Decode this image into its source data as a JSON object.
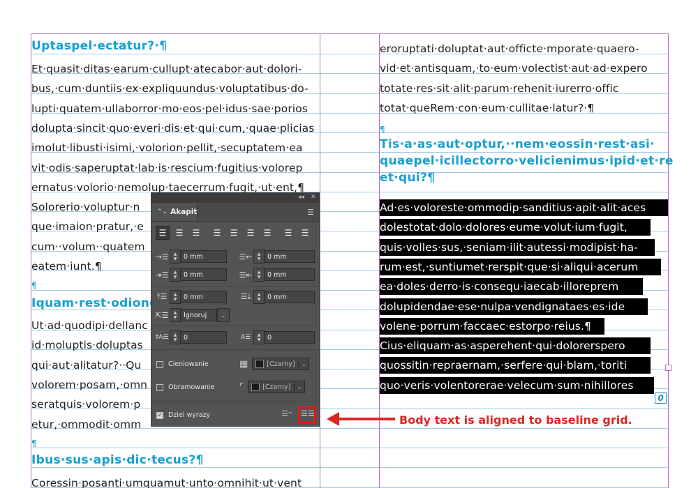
{
  "left_column": {
    "heading1": "Uptaspel·ectatur?·¶",
    "para1": [
      "Et·quasit·ditas·earum·cullupt·atecabor·aut·dolori-",
      "bus,·cum·duntiis·ex·expliquundus·voluptatibus·do-",
      "lupti·quatem·ullaborror·mo·eos·pel·idus·sae·porios",
      "dolupta·sincit·quo·everi·dis·et·qui·cum,·quae·plicias",
      "imolut·libusti·isimi,·volorion·pellit,·secuptatem·ea",
      "vit·odis·saperuptat·lab·is·rescium·fugitius·volorep",
      "ernatus·volorio·nemolup·taecerrum·fugit,·ut·ent,¶",
      "Solorerio·voluptur·n",
      "que·imaion·pratur,·e",
      "cum··volum··quatem",
      "eatem·iunt.¶"
    ],
    "empty_pilcrow1": "¶",
    "heading2": "Iquam·rest·odione",
    "para2": [
      "Ut·ad·quodipi·dellanc",
      "id·moluptis·doluptas",
      "qui·aut·alitatur?··Qu",
      "volorem·posam,·omn",
      "seratquis·volorem·p",
      "etur,·ommodit·omm"
    ],
    "empty_pilcrow2": "¶",
    "heading3": "Ibus·sus·apis·dic·tecus?¶",
    "para3": [
      "Coressin·posanti·umquamut·unto·omnihit·ut·vent"
    ]
  },
  "right_column": {
    "para1": [
      "eroruptati·doluptat·aut·officte·mporate·quaero-",
      "vid·et·antisquam,·to·eum·volectist·aut·ad·expero",
      "totate·res·sit·alit·parum·rehenit·iurerro·offic",
      "totat·queRem·con·eum·cullitae·latur?·¶"
    ],
    "empty_pilcrow": "¶",
    "heading": [
      "Tis·a·as·aut·optur,··nem·eossin·rest·asi·",
      "quaepel·icillectorro·velicienimus·ipid·et·re",
      "et·qui?¶"
    ],
    "selected_para": [
      "Ad·es·voloreste·ommodip·sanditius·apit·alit·aces",
      "dolestotat·dolo·dolores·eume·volut·ium·fugit,",
      "quis·volles·sus,·seniam·ilit·autessi·modipist·ha-",
      "rum·est,·suntiumet·rerspit·que·si·aliqui·acerum",
      "ea·doles·derro·is·consequ·iaecab·illoreprem",
      "dolupidendae·ese·nulpa·vendignataes·es·ide",
      "volene·porrum·faccaec·estorpo·reius.¶",
      "Cius·eliquam·as·asperehent·qui·dolorerspero",
      "quossitin·repraernam,·serfere·qui·blam,·toriti",
      "quo·veris·volentorerae·velecum·sum·nihillores"
    ],
    "overflow_marker": "0"
  },
  "panel": {
    "tab_label": "Akapit",
    "left_indent": "0 mm",
    "right_indent": "0 mm",
    "first_line_indent": "0 mm",
    "last_line_indent": "0 mm",
    "space_before": "0 mm",
    "space_after": "0 mm",
    "drop_cap_select": "Ignoruj",
    "drop_cap_lines": "0",
    "drop_cap_chars": "0",
    "shading_label": "Cieniowanie",
    "shading_color": "[Czarny]",
    "border_label": "Obramowanie",
    "border_color": "[Czarny]",
    "hyphenate_label": "Dziel wyrazy"
  },
  "annotation": {
    "text": "Body text is aligned to baseline grid."
  }
}
